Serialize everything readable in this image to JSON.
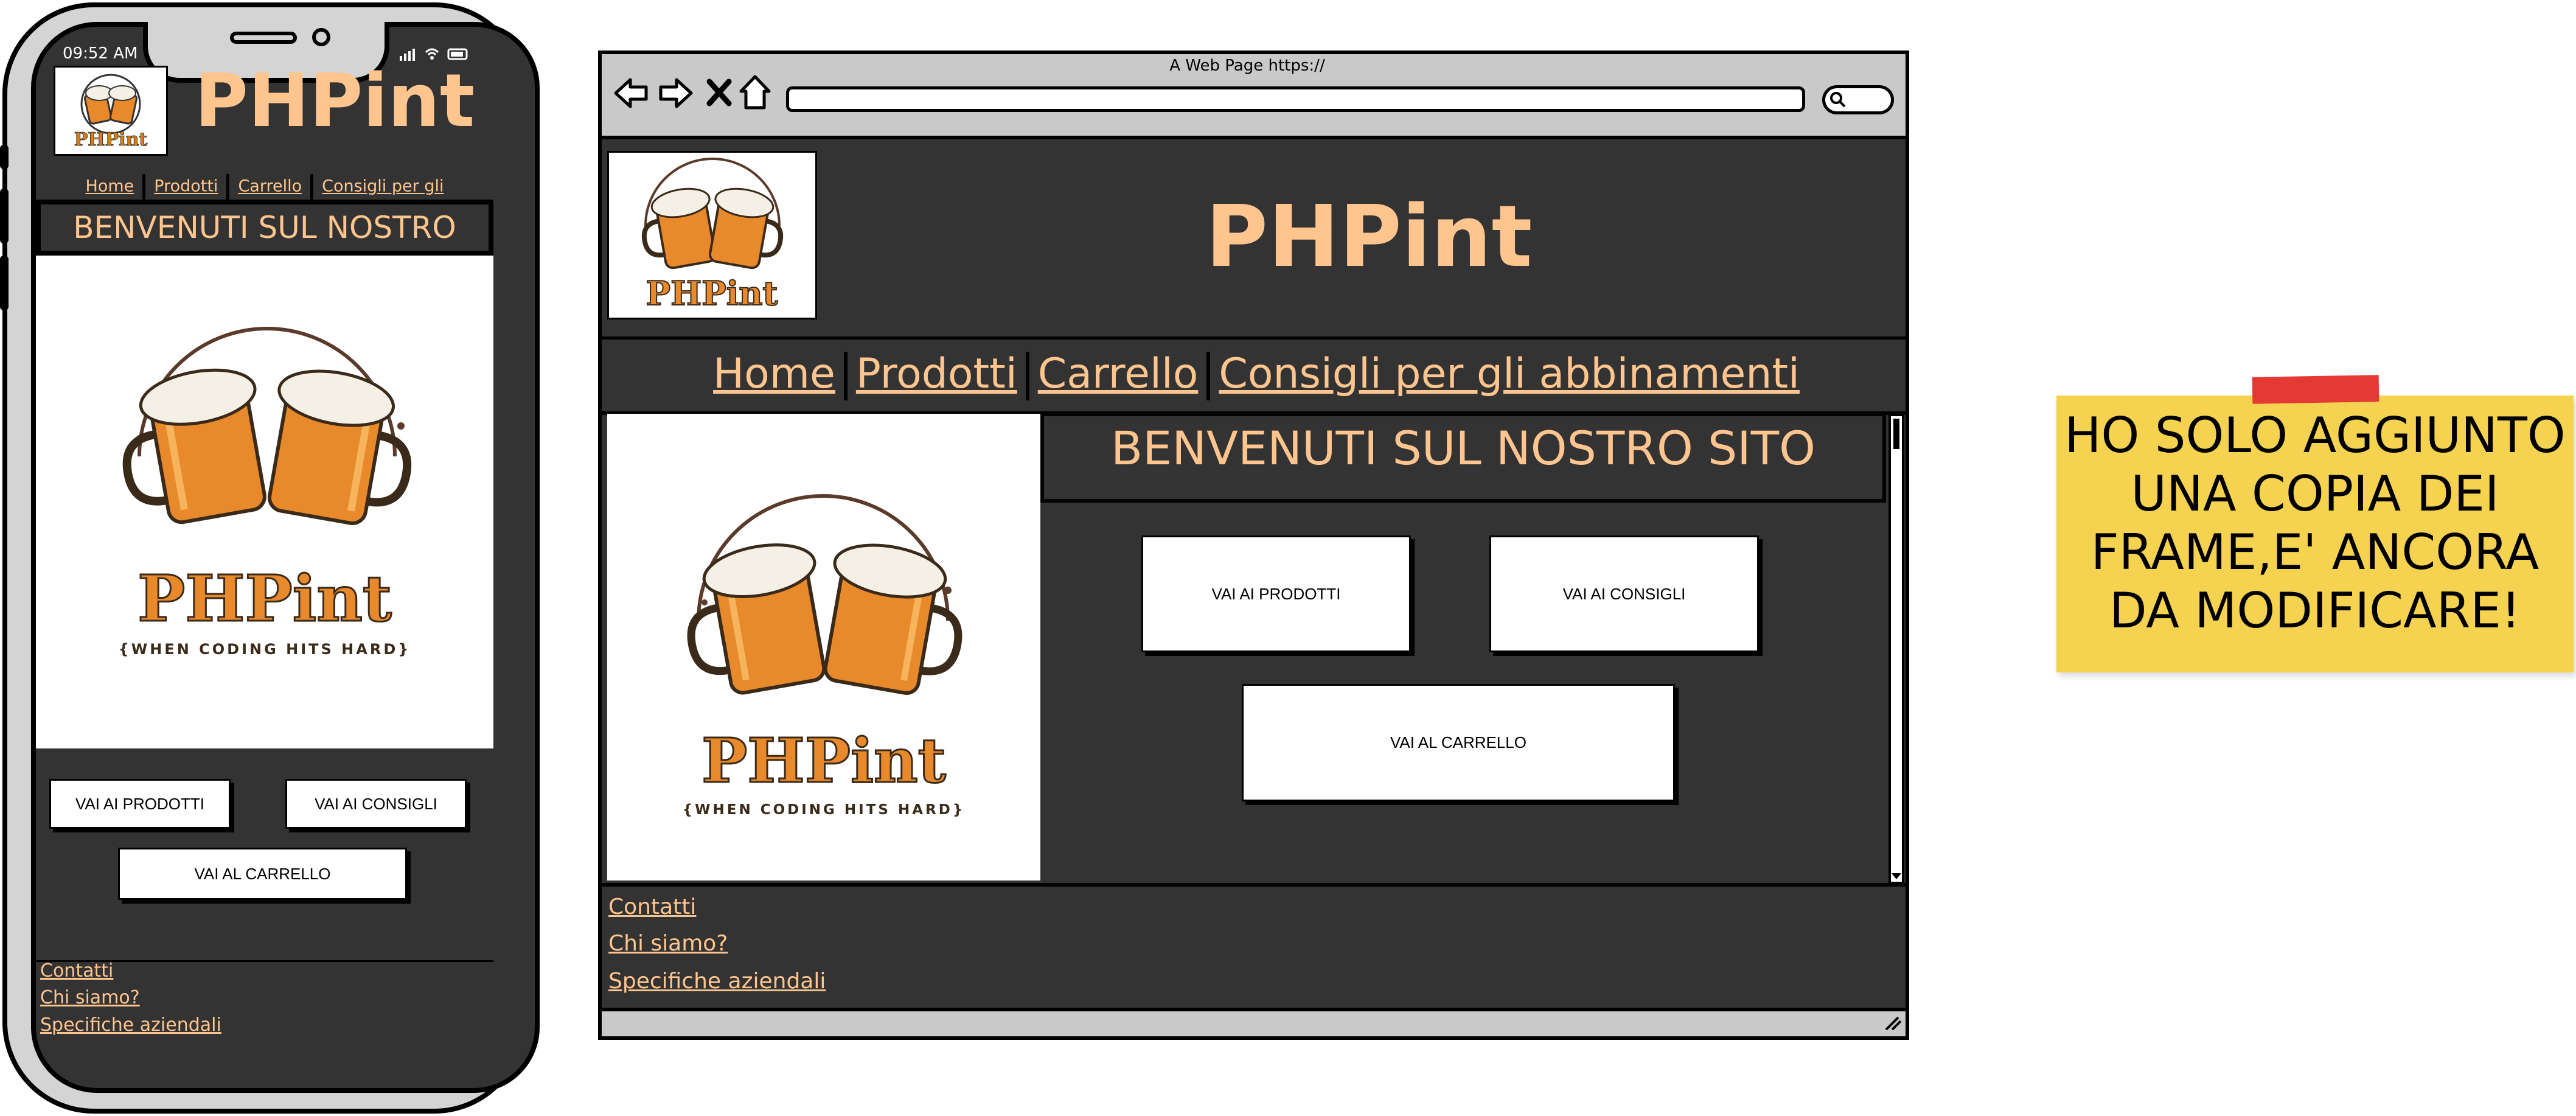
{
  "phone": {
    "time": "09:52 AM",
    "brand_title": "PHPint",
    "nav": [
      "Home",
      "Prodotti",
      "Carrello",
      "Consigli per gli abbinamenti"
    ],
    "welcome": "BENVENUTI SUL NOSTRO SITO",
    "buttons": {
      "products": "VAI AI PRODOTTI",
      "tips": "VAI AI CONSIGLI",
      "cart": "VAI AL CARRELLO"
    },
    "footer_links": [
      "Contatti",
      "Chi siamo?",
      "Specifiche aziendali"
    ]
  },
  "browser": {
    "window_title": "A Web Page https://",
    "brand_title": "PHPint",
    "nav": [
      "Home",
      "Prodotti",
      "Carrello",
      "Consigli per gli abbinamenti"
    ],
    "welcome": "BENVENUTI SUL NOSTRO SITO",
    "buttons": {
      "products": "VAI AI PRODOTTI",
      "tips": "VAI AI CONSIGLI",
      "cart": "VAI AL CARRELLO"
    },
    "footer_links": [
      "Contatti",
      "Chi siamo?",
      "Specifiche aziendali"
    ]
  },
  "logo": {
    "name": "PHPint",
    "tagline": "{WHEN CODING HITS HARD}"
  },
  "note": {
    "lines": [
      "HO SOLO AGGIUNTO",
      "UNA COPIA DEI",
      "FRAME,E' ANCORA",
      "DA MODIFICARE!"
    ]
  },
  "colors": {
    "background_dark": "#333333",
    "accent_orange": "#ffc58f",
    "note_yellow": "#f5d350",
    "tape_red": "#e53935"
  }
}
